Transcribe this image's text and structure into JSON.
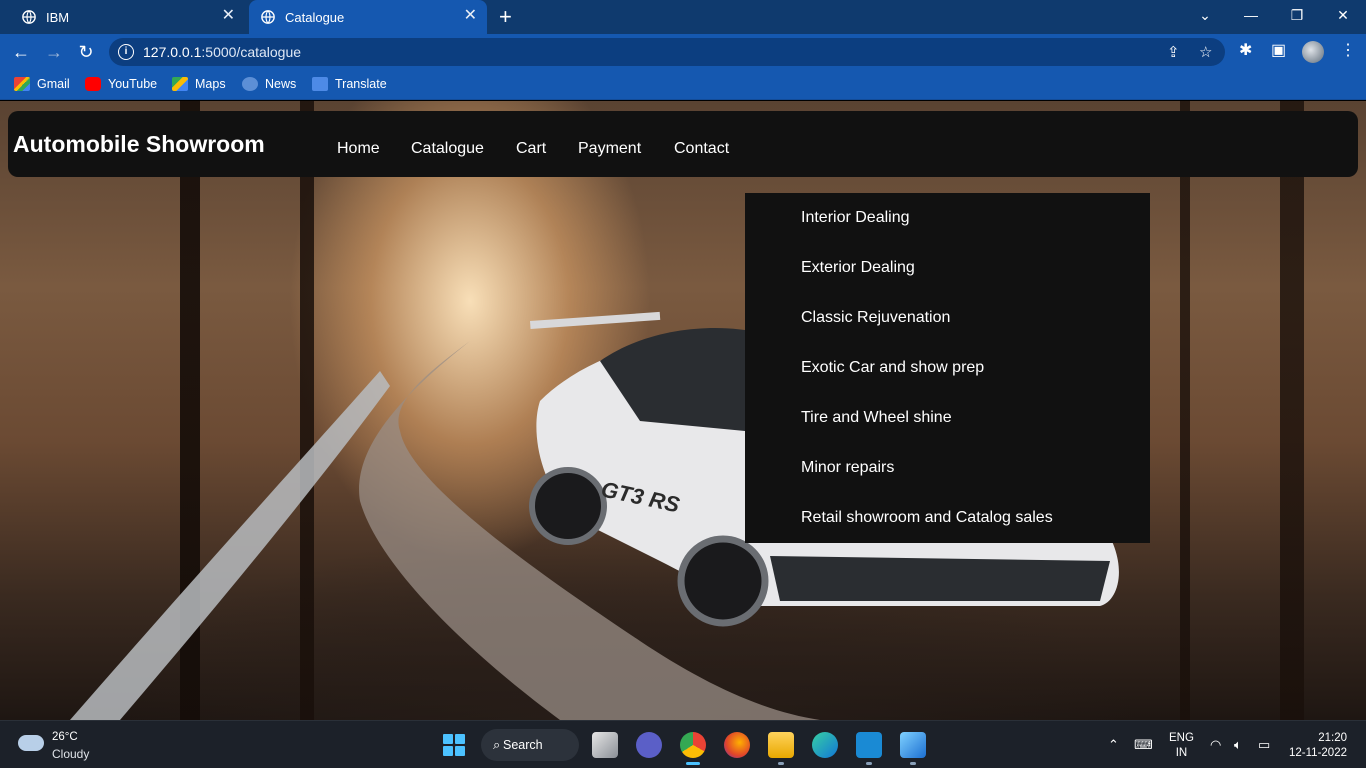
{
  "browser": {
    "tabs": [
      {
        "title": "IBM",
        "active": false
      },
      {
        "title": "Catalogue",
        "active": true
      }
    ],
    "url_host": "127.0.0.1",
    "url_path": ":5000/catalogue",
    "bookmarks": [
      "Gmail",
      "YouTube",
      "Maps",
      "News",
      "Translate"
    ]
  },
  "site": {
    "brand": "Automobile Showroom",
    "nav": [
      "Home",
      "Catalogue",
      "Cart",
      "Payment",
      "Contact"
    ],
    "catalogue_menu": [
      "Interior Dealing",
      "Exterior Dealing",
      "Classic Rejuvenation",
      "Exotic Car and show prep",
      "Tire and Wheel shine",
      "Minor repairs",
      "Retail showroom and Catalog sales"
    ],
    "car_decal": "GT3 RS"
  },
  "taskbar": {
    "weather_temp": "26°C",
    "weather_cond": "Cloudy",
    "search_label": "Search",
    "lang": "ENG",
    "region": "IN",
    "time": "21:20",
    "date": "12-11-2022"
  },
  "colors": {
    "tabstrip": "#0f3a6e",
    "toolbar": "#1558b0",
    "navbar": "#111111",
    "taskbar": "#1c2129"
  }
}
